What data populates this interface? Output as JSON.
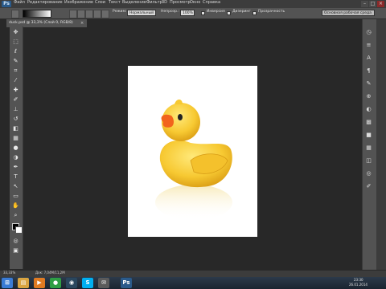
{
  "app": {
    "logo": "Ps"
  },
  "menu": {
    "items": [
      "Файл",
      "Редактирование",
      "Изображение",
      "Слои",
      "Текст",
      "Выделение",
      "Фильтр",
      "3D",
      "Просмотр",
      "Окно",
      "Справка"
    ]
  },
  "window_controls": {
    "minimize": "–",
    "maximize": "□",
    "close": "×"
  },
  "options": {
    "mode_label": "Режим:",
    "mode_value": "Нормальный",
    "opacity_label": "Непрозр.:",
    "opacity_value": "100%",
    "reverse_label": "Инверсия",
    "dither_label": "Дизеринг",
    "transparency_label": "Прозрачность",
    "workspace_value": "Основная рабочая среда"
  },
  "document": {
    "tab_title": "duck.psd @ 33,3% (Слой 0, RGB/8)",
    "tab_close": "×"
  },
  "status": {
    "zoom": "33,33%",
    "doc_size": "Док: 7,04М/11,2М"
  },
  "taskbar": {
    "apps": [
      {
        "name": "start-orb",
        "glyph": "⊞",
        "color": "#3a7bd5"
      },
      {
        "name": "explorer",
        "glyph": "▤",
        "color": "#d9a441"
      },
      {
        "name": "media",
        "glyph": "▶",
        "color": "#e07b22"
      },
      {
        "name": "chrome",
        "glyph": "●",
        "color": "#2f9e44"
      },
      {
        "name": "steam",
        "glyph": "◉",
        "color": "#2a475e"
      },
      {
        "name": "skype",
        "glyph": "S",
        "color": "#00aff0"
      },
      {
        "name": "app6",
        "glyph": "✉",
        "color": "#5a5a5a"
      },
      {
        "name": "photoshop",
        "glyph": "Ps",
        "color": "#1c3f63"
      }
    ],
    "clock_time": "23:30",
    "clock_date": "26.01.2014"
  },
  "colors": {
    "accent": "#2a5a8a",
    "canvas_bg": "#282828",
    "panel": "#535353"
  }
}
